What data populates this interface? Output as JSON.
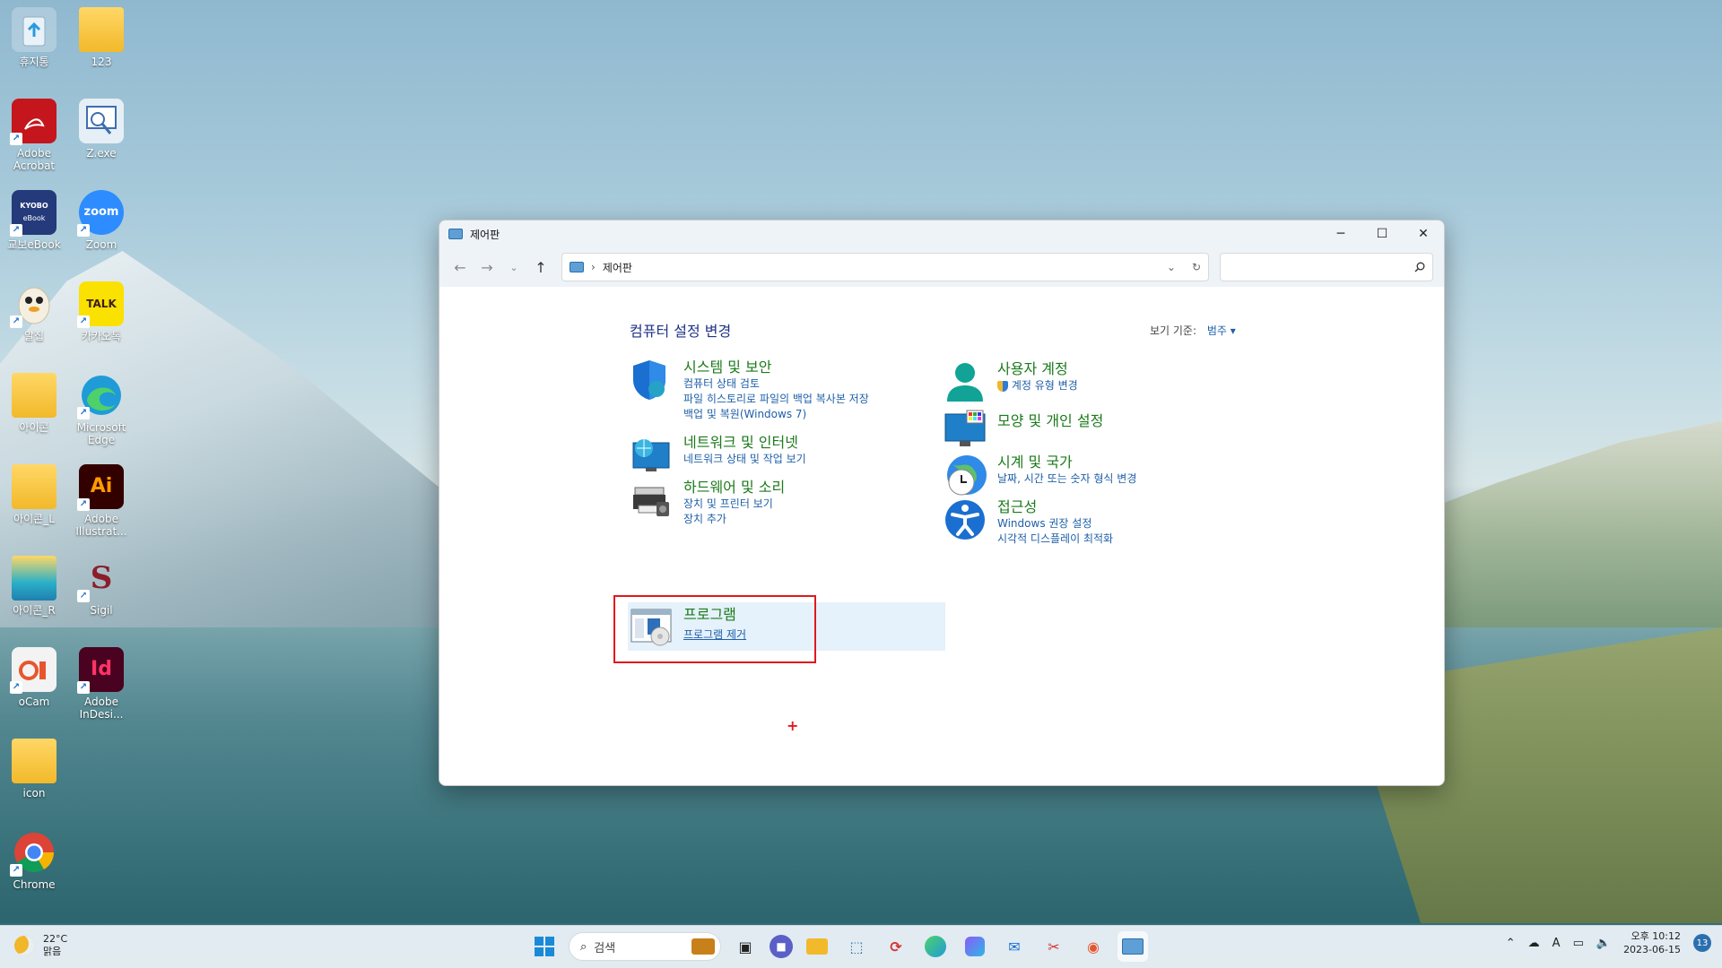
{
  "desktop": {
    "icons": [
      {
        "label": "휴지통"
      },
      {
        "label": "123"
      },
      {
        "label": "Adobe Acrobat"
      },
      {
        "label": "Z.exe"
      },
      {
        "label": "교보eBook"
      },
      {
        "label": "Zoom"
      },
      {
        "label": "알집"
      },
      {
        "label": "카카오톡"
      },
      {
        "label": "아이콘"
      },
      {
        "label": "Microsoft Edge"
      },
      {
        "label": "아이콘_L"
      },
      {
        "label": "Adobe Illustrat..."
      },
      {
        "label": "아이콘_R"
      },
      {
        "label": "Sigil"
      },
      {
        "label": "oCam"
      },
      {
        "label": "Adobe InDesi..."
      },
      {
        "label": "icon"
      },
      {
        "label": "Chrome"
      }
    ],
    "icon_glyphs": {
      "kyobo": "KYOBO",
      "kyobo_sub": "eBook",
      "zoom": "zoom",
      "talk": "TALK",
      "ai": "Ai",
      "id": "Id",
      "sigil": "S"
    }
  },
  "window": {
    "title": "제어판",
    "address": "제어판",
    "search_placeholder": "",
    "heading": "컴퓨터 설정 변경",
    "view_by_label": "보기 기준:",
    "view_by_value": "범주 ▾",
    "categories_left": [
      {
        "title": "시스템 및 보안",
        "links": [
          "컴퓨터 상태 검토",
          "파일 히스토리로 파일의 백업 복사본 저장",
          "백업 및 복원(Windows 7)"
        ]
      },
      {
        "title": "네트워크 및 인터넷",
        "links": [
          "네트워크 상태 및 작업 보기"
        ]
      },
      {
        "title": "하드웨어 및 소리",
        "links": [
          "장치 및 프린터 보기",
          "장치 추가"
        ]
      },
      {
        "title": "프로그램",
        "links": [
          "프로그램 제거"
        ]
      }
    ],
    "categories_right": [
      {
        "title": "사용자 계정",
        "links": [
          "계정 유형 변경"
        ]
      },
      {
        "title": "모양 및 개인 설정",
        "links": []
      },
      {
        "title": "시계 및 국가",
        "links": [
          "날짜, 시간 또는 숫자 형식 변경"
        ]
      },
      {
        "title": "접근성",
        "links": [
          "Windows 권장 설정",
          "시각적 디스플레이 최적화"
        ]
      }
    ]
  },
  "taskbar": {
    "weather_temp": "22°C",
    "weather_desc": "맑음",
    "search_label": "검색",
    "clock_ampm_time": "오후 10:12",
    "clock_date": "2023-06-15",
    "notification_count": "13",
    "ime_label": "A"
  },
  "colors": {
    "accent": "#1a8ad8",
    "highlight_box": "#e0191e",
    "category_title": "#1b7a1b",
    "link": "#1f5fa8"
  }
}
